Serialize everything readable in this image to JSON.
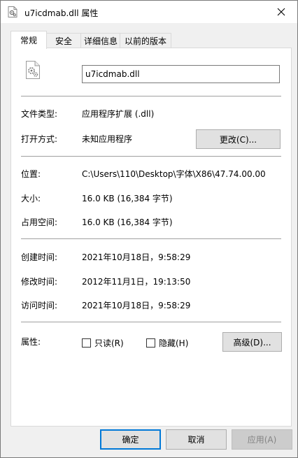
{
  "window": {
    "title": "u7icdmab.dll 属性",
    "icon": "dll-file-icon",
    "close_icon": "close-icon"
  },
  "tabs": [
    {
      "label": "常规",
      "active": true
    },
    {
      "label": "安全",
      "active": false
    },
    {
      "label": "详细信息",
      "active": false
    },
    {
      "label": "以前的版本",
      "active": false
    }
  ],
  "general": {
    "file_name": "u7icdmab.dll",
    "file_type_label": "文件类型:",
    "file_type_value": "应用程序扩展 (.dll)",
    "open_with_label": "打开方式:",
    "open_with_value": "未知应用程序",
    "change_button": "更改(C)...",
    "location_label": "位置:",
    "location_value": "C:\\Users\\110\\Desktop\\字体\\X86\\47.74.00.00",
    "size_label": "大小:",
    "size_value": "16.0 KB (16,384 字节)",
    "size_on_disk_label": "占用空间:",
    "size_on_disk_value": "16.0 KB (16,384 字节)",
    "created_label": "创建时间:",
    "created_value": "2021年10月18日，9:58:29",
    "modified_label": "修改时间:",
    "modified_value": "2012年11月1日，19:13:50",
    "accessed_label": "访问时间:",
    "accessed_value": "2021年10月18日，9:58:29",
    "attributes_label": "属性:",
    "readonly_label": "只读(R)",
    "readonly_checked": false,
    "hidden_label": "隐藏(H)",
    "hidden_checked": false,
    "advanced_button": "高级(D)..."
  },
  "footer": {
    "ok": "确定",
    "cancel": "取消",
    "apply": "应用(A)"
  },
  "colors": {
    "accent": "#0078d7",
    "panel_bg": "#ffffff",
    "window_bg": "#f0f0f0"
  }
}
